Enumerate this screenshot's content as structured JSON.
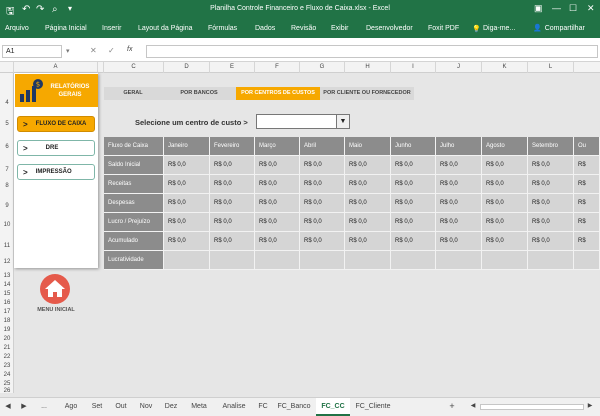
{
  "window": {
    "title": "Planilha Controle Financeiro e Fluxo de Caixa.xlsx - Excel"
  },
  "ribbon": {
    "tabs": [
      "Arquivo",
      "Página Inicial",
      "Inserir",
      "Layout da Página",
      "Fórmulas",
      "Dados",
      "Revisão",
      "Exibir",
      "Desenvolvedor",
      "Foxit PDF"
    ],
    "tell_me": "Diga-me...",
    "share": "Compartilhar"
  },
  "formula_bar": {
    "name_box": "A1",
    "cancel": "✕",
    "confirm": "✓",
    "fx": "fx",
    "value": ""
  },
  "columns": [
    "A",
    "B",
    "C",
    "D",
    "E",
    "F",
    "G",
    "H",
    "I",
    "J",
    "K",
    "L"
  ],
  "rows": [
    "4",
    "5",
    "6",
    "7",
    "8",
    "9",
    "10",
    "11",
    "12",
    "13",
    "14",
    "15",
    "16",
    "17",
    "18",
    "19",
    "20",
    "21",
    "22",
    "23",
    "24",
    "25",
    "26"
  ],
  "sidebar": {
    "title_line1": "RELATÓRIOS",
    "title_line2": "GERAIS",
    "buttons": [
      {
        "arrow": ">",
        "label": "FLUXO DE CAIXA"
      },
      {
        "arrow": ">",
        "label": "DRE"
      },
      {
        "arrow": ">",
        "label": "IMPRESSÃO"
      }
    ],
    "home_label": "MENU INICIAL"
  },
  "nav_tabs": [
    "GERAL",
    "POR BANCOS",
    "POR CENTROS DE CUSTOS",
    "POR CLIENTE OU FORNECEDOR"
  ],
  "selector": {
    "label": "Selecione um centro de custo >",
    "value": "",
    "arrow": "▼"
  },
  "grid": {
    "header": "Fluxo de Caixa",
    "months": [
      "Janeiro",
      "Fevereiro",
      "Março",
      "Abril",
      "Maio",
      "Junho",
      "Julho",
      "Agosto",
      "Setembro",
      "Ou"
    ],
    "rows": [
      {
        "label": "Saldo Inicial",
        "values": [
          "R$ 0,0",
          "R$ 0,0",
          "R$ 0,0",
          "R$ 0,0",
          "R$ 0,0",
          "R$ 0,0",
          "R$ 0,0",
          "R$ 0,0",
          "R$ 0,0",
          "R$"
        ]
      },
      {
        "label": "Receitas",
        "values": [
          "R$ 0,0",
          "R$ 0,0",
          "R$ 0,0",
          "R$ 0,0",
          "R$ 0,0",
          "R$ 0,0",
          "R$ 0,0",
          "R$ 0,0",
          "R$ 0,0",
          "R$"
        ]
      },
      {
        "label": "Despesas",
        "values": [
          "R$ 0,0",
          "R$ 0,0",
          "R$ 0,0",
          "R$ 0,0",
          "R$ 0,0",
          "R$ 0,0",
          "R$ 0,0",
          "R$ 0,0",
          "R$ 0,0",
          "R$"
        ]
      },
      {
        "label": "Lucro / Prejuízo",
        "values": [
          "R$ 0,0",
          "R$ 0,0",
          "R$ 0,0",
          "R$ 0,0",
          "R$ 0,0",
          "R$ 0,0",
          "R$ 0,0",
          "R$ 0,0",
          "R$ 0,0",
          "R$"
        ]
      },
      {
        "label": "Acumulado",
        "values": [
          "R$ 0,0",
          "R$ 0,0",
          "R$ 0,0",
          "R$ 0,0",
          "R$ 0,0",
          "R$ 0,0",
          "R$ 0,0",
          "R$ 0,0",
          "R$ 0,0",
          "R$"
        ]
      },
      {
        "label": "Lucratividade",
        "values": [
          "",
          "",
          "",
          "",
          "",
          "",
          "",
          "",
          "",
          ""
        ]
      }
    ]
  },
  "sheet_tabs": [
    "Ago",
    "Set",
    "Out",
    "Nov",
    "Dez",
    "Meta",
    "Analise",
    "FC",
    "FC_Banco",
    "FC_CC",
    "FC_Cliente"
  ],
  "active_sheet": "FC_CC",
  "sheet_nav": {
    "prev": "◀",
    "next": "▶",
    "more": "...",
    "add": "+"
  },
  "colors": {
    "excel_green": "#217346",
    "accent": "#f6a800",
    "grid_header": "#8c8c8c",
    "grid_value": "#d5d5d5",
    "home": "#e55a4b"
  }
}
